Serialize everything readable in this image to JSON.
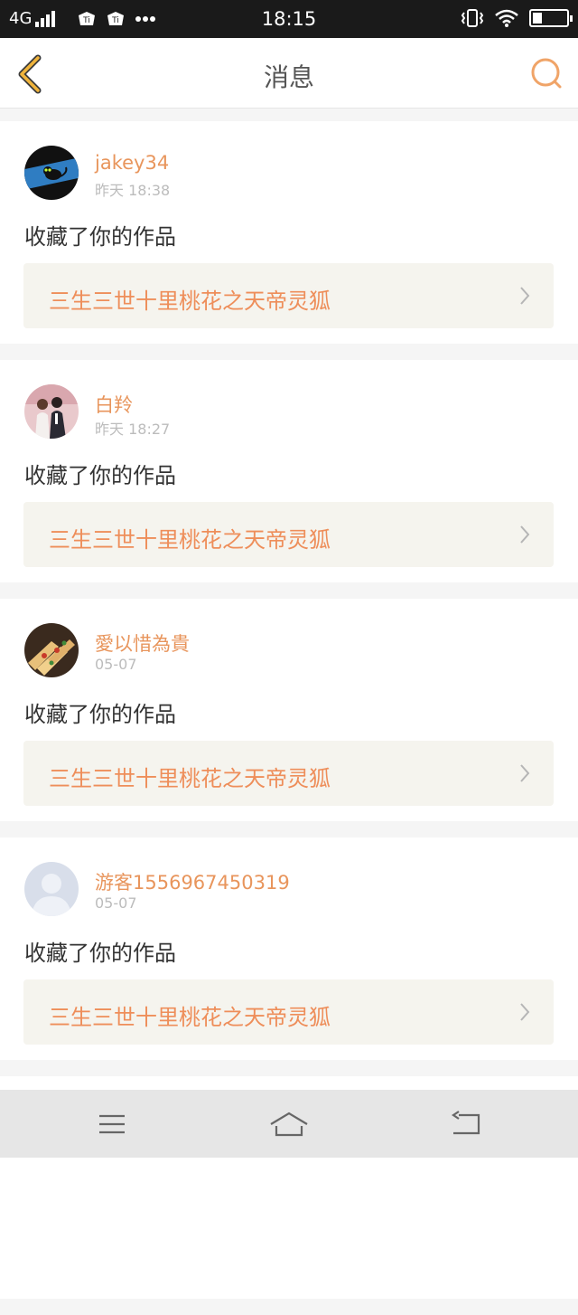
{
  "status_bar": {
    "network": "4G",
    "time": "18:15"
  },
  "header": {
    "title": "消息"
  },
  "messages": [
    {
      "username": "jakey34",
      "time": "昨天 18:38",
      "action": "收藏了你的作品",
      "work_title": "三生三世十里桃花之天帝灵狐"
    },
    {
      "username": "白羚",
      "time": "昨天 18:27",
      "action": "收藏了你的作品",
      "work_title": "三生三世十里桃花之天帝灵狐"
    },
    {
      "username": "愛以惜為貴",
      "time": "05-07",
      "action": "收藏了你的作品",
      "work_title": "三生三世十里桃花之天帝灵狐"
    },
    {
      "username": "游客1556967450319",
      "time": "05-07",
      "action": "收藏了你的作品",
      "work_title": "三生三世十里桃花之天帝灵狐"
    }
  ],
  "colors": {
    "accent": "#e8955c",
    "header_icon": "#e8a838",
    "card_bg": "#ffffff",
    "work_bg": "#f5f4ee"
  },
  "icons": {
    "back": "back-chevron-icon",
    "search": "search-icon",
    "menu": "menu-icon",
    "home": "home-icon",
    "return": "return-icon"
  }
}
